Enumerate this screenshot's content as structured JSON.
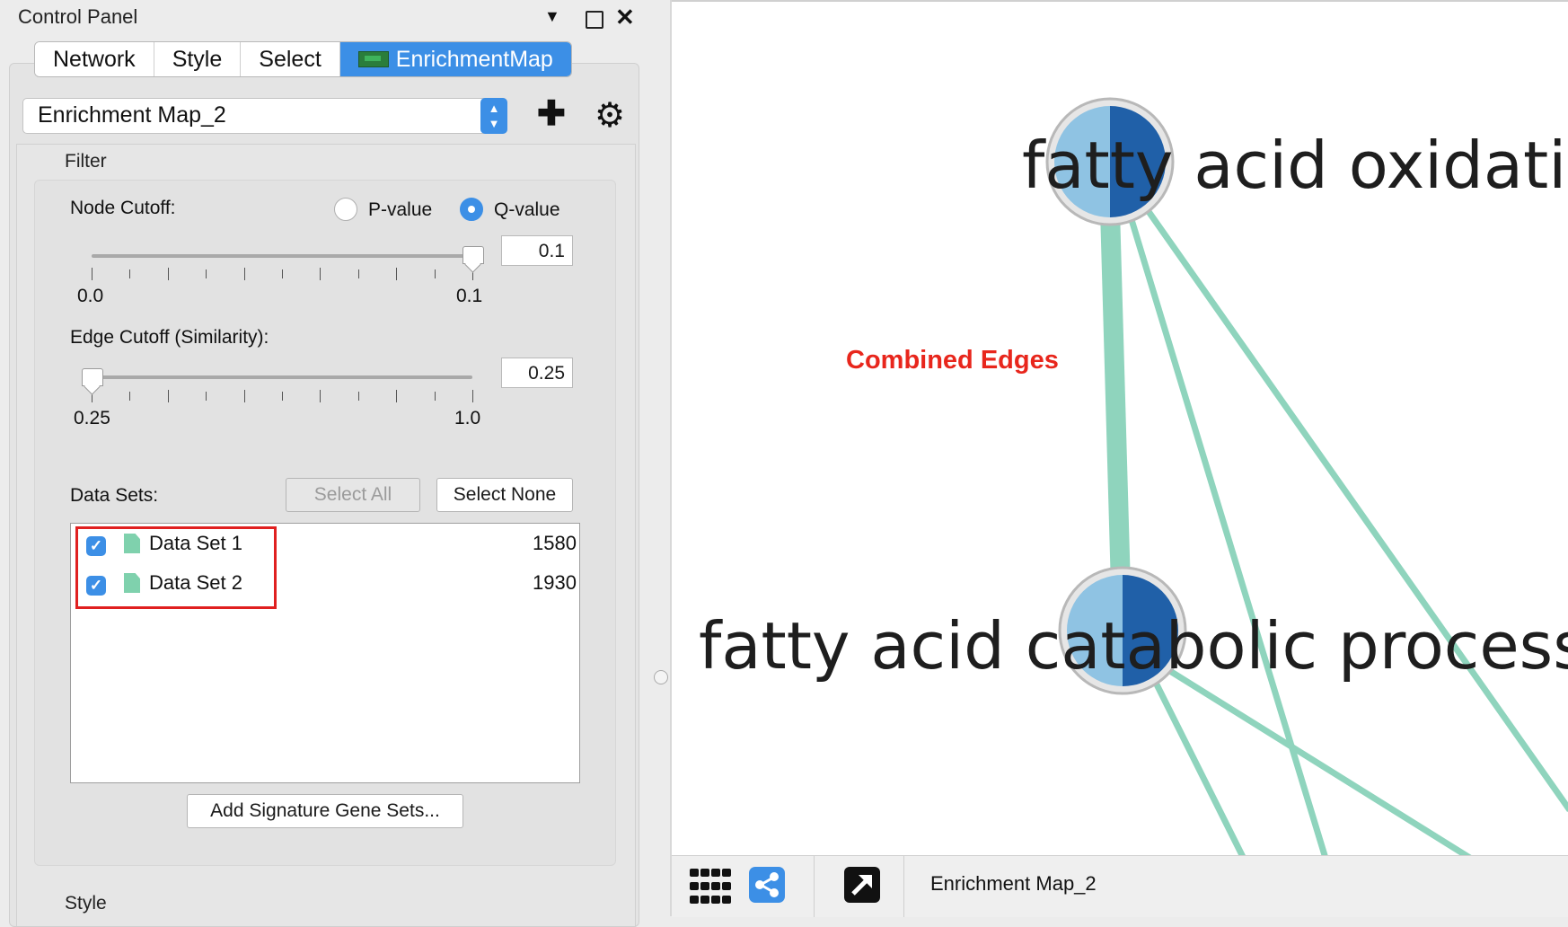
{
  "panel": {
    "title": "Control Panel",
    "tabs": [
      {
        "label": "Network"
      },
      {
        "label": "Style"
      },
      {
        "label": "Select"
      },
      {
        "label": "EnrichmentMap",
        "active": true
      }
    ],
    "map_select_value": "Enrichment Map_2",
    "filter": {
      "section_label": "Filter",
      "node_cutoff_label": "Node Cutoff:",
      "radio_pvalue": "P-value",
      "radio_qvalue": "Q-value",
      "selected_radio": "Q-value",
      "node_value": "0.1",
      "node_min": "0.0",
      "node_max": "0.1",
      "node_slider_fraction": 1.0,
      "edge_cutoff_label": "Edge Cutoff (Similarity):",
      "edge_value": "0.25",
      "edge_min": "0.25",
      "edge_max": "1.0",
      "edge_slider_fraction": 0.0
    },
    "datasets": {
      "label": "Data Sets:",
      "select_all": "Select All",
      "select_none": "Select None",
      "items": [
        {
          "name": "Data Set 1",
          "count": "1580",
          "checked": true
        },
        {
          "name": "Data Set 2",
          "count": "1930",
          "checked": true
        }
      ],
      "add_signature": "Add Signature Gene Sets..."
    },
    "style_section_label": "Style"
  },
  "network": {
    "annotation": "Combined Edges",
    "annotation_color": "#e8261c",
    "nodes": [
      {
        "label": "fatty acid oxidation"
      },
      {
        "label": "fatty acid catabolic process"
      }
    ],
    "node_colors": {
      "left": "#8fc3e3",
      "right": "#2060a8"
    },
    "edge_color": "#8fd4bd",
    "view_name": "Enrichment Map_2"
  },
  "colors": {
    "accent": "#3c8fe6",
    "highlight": "#e02020"
  }
}
